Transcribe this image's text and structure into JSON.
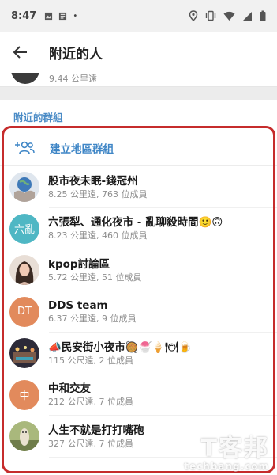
{
  "status_bar": {
    "time": "8:47",
    "dot": "•"
  },
  "toolbar": {
    "title": "附近的人"
  },
  "previous_row": {
    "distance": "9.44 公里遠"
  },
  "section": {
    "header": "附近的群組"
  },
  "create_group": {
    "label": "建立地區群組"
  },
  "groups": [
    {
      "name": "股市夜未眠-錢冠州",
      "subtitle": "8.25 公里遠, 763 位成員",
      "avatar_text": "",
      "avatar_color": "#9fb4cf"
    },
    {
      "name": "六張犁、通化夜市 - 亂聊殺時間🙂🙃",
      "subtitle": "8.23 公里遠, 460 位成員",
      "avatar_text": "六亂",
      "avatar_color": "#4fb7c4"
    },
    {
      "name": "kpop討論區",
      "subtitle": "5.72 公里遠, 51 位成員",
      "avatar_text": "",
      "avatar_color": "#c79b86"
    },
    {
      "name": "DDS team",
      "subtitle": "6.37 公里遠, 9 位成員",
      "avatar_text": "DT",
      "avatar_color": "#e28a5c"
    },
    {
      "name": "📣民安街小夜市🥘🍧🍦🍽🍺",
      "subtitle": "115 公尺遠, 2 位成員",
      "avatar_text": "",
      "avatar_color": "#5a4a48"
    },
    {
      "name": "中和交友",
      "subtitle": "212 公尺遠, 7 位成員",
      "avatar_text": "中",
      "avatar_color": "#e28a5c"
    },
    {
      "name": "人生不就是打打嘴砲",
      "subtitle": "327 公尺遠, 7 位成員",
      "avatar_text": "",
      "avatar_color": "#8a7a62"
    }
  ],
  "watermark": {
    "cn": "T客邦",
    "en": "techbang.com"
  },
  "colors": {
    "accent": "#3f86c6",
    "highlight": "#c62c2c"
  }
}
